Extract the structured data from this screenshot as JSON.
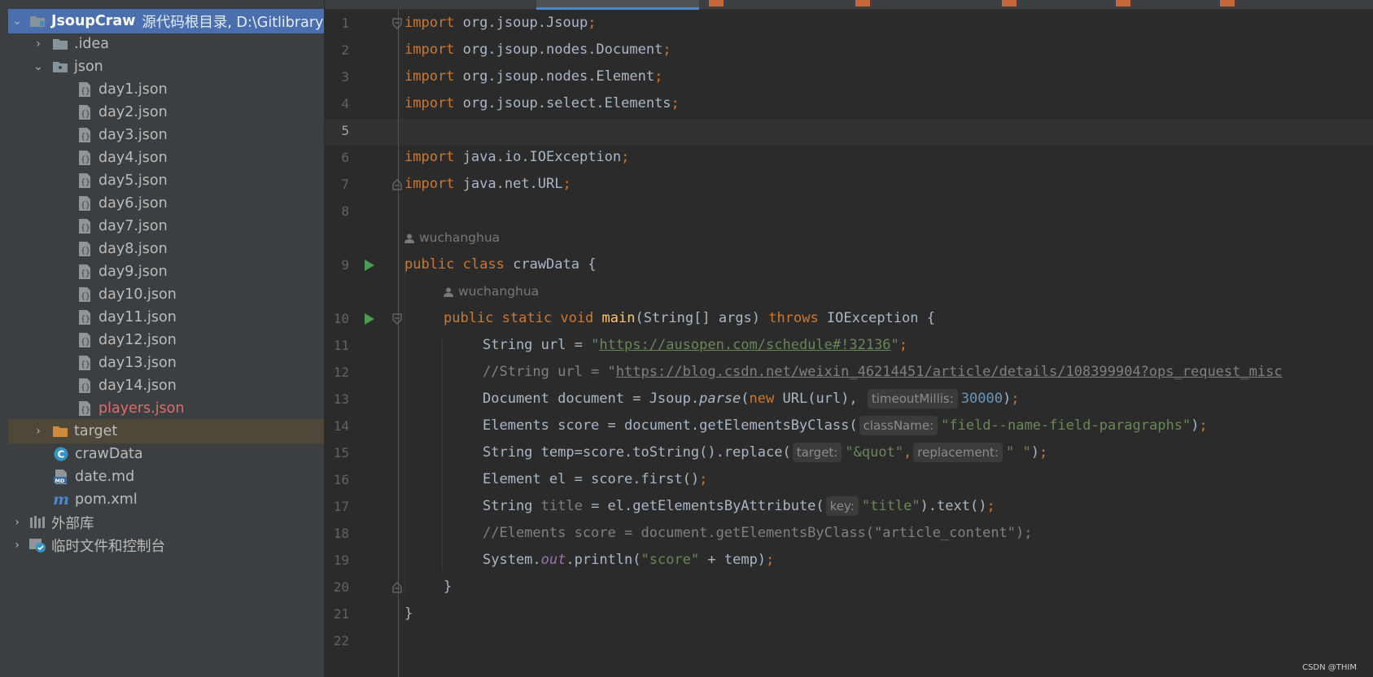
{
  "project_panel": {
    "root_name": "JsoupCraw",
    "root_path": "源代码根目录, D:\\Gitlibrary",
    "items": [
      {
        "label": ".idea"
      },
      {
        "label": "json"
      },
      {
        "label": "day1.json"
      },
      {
        "label": "day2.json"
      },
      {
        "label": "day3.json"
      },
      {
        "label": "day4.json"
      },
      {
        "label": "day5.json"
      },
      {
        "label": "day6.json"
      },
      {
        "label": "day7.json"
      },
      {
        "label": "day8.json"
      },
      {
        "label": "day9.json"
      },
      {
        "label": "day10.json"
      },
      {
        "label": "day11.json"
      },
      {
        "label": "day12.json"
      },
      {
        "label": "day13.json"
      },
      {
        "label": "day14.json"
      },
      {
        "label": "players.json"
      },
      {
        "label": "target"
      },
      {
        "label": "crawData"
      },
      {
        "label": "date.md"
      },
      {
        "label": "pom.xml"
      },
      {
        "label": "外部库"
      },
      {
        "label": "临时文件和控制台"
      }
    ]
  },
  "editor": {
    "line_numbers": [
      "1",
      "2",
      "3",
      "4",
      "5",
      "6",
      "7",
      "8",
      "9",
      "10",
      "11",
      "12",
      "13",
      "14",
      "15",
      "16",
      "17",
      "18",
      "19",
      "20",
      "21",
      "22"
    ],
    "author": "wuchanghua",
    "tokens": {
      "import": "import",
      "public": "public",
      "class": "class",
      "static": "static",
      "void": "void",
      "throws": "throws",
      "new": "new",
      "semi": ";",
      "l1": "org.jsoup.Jsoup",
      "l2": "org.jsoup.nodes.Document",
      "l3": "org.jsoup.nodes.Element",
      "l4": "org.jsoup.select.Elements",
      "l6": "java.io.IOException",
      "l7": "java.net.URL",
      "class_name": " crawData {",
      "main": "main",
      "main_rest": "(String[] args) ",
      "ioexc": " IOException {",
      "l11_a": "String url = ",
      "l11_url": "https://ausopen.com/schedule#!32136",
      "l12_a": "//String url = \"",
      "l12_url": "https://blog.csdn.net/weixin_46214451/article/details/108399904?ops_request_misc",
      "l13_a": "Document document = Jsoup.",
      "parse": "parse",
      "l13_b": "(",
      "l13_c": " URL(url), ",
      "hint_timeout": "timeoutMillis:",
      "num_30000": "30000",
      "l13_d": ")",
      "l14_a": "Elements score = document.getElementsByClass(",
      "hint_classname": "className:",
      "l14_str": "\"field--name-field-paragraphs\"",
      "l14_b": ")",
      "l15_a": "String temp=score.toString().replace(",
      "hint_target": "target:",
      "l15_str1": "\"&quot\"",
      "comma": ",",
      "hint_replacement": "replacement:",
      "l15_str2": "\" \"",
      "l15_b": ")",
      "l16_a": "Element el = score.first()",
      "l17_a": "String ",
      "title": "title",
      "l17_b": " = el.getElementsByAttribute(",
      "hint_key": "key:",
      "l17_str": "\"title\"",
      "l17_c": ").text()",
      "l18": "//Elements score = document.getElementsByClass(\"article_content\");",
      "l19_a": "System.",
      "out": "out",
      "l19_b": ".println(",
      "l19_str": "\"score\"",
      "l19_c": " + temp)",
      "rbrace": "}",
      "quote": "\""
    }
  },
  "watermark": "CSDN @THIM",
  "colors": {
    "keyword": "#cc7832",
    "string": "#6a8759",
    "comment": "#808080",
    "method": "#ffc66d",
    "number": "#6897bb",
    "selection": "#4b6eaf"
  }
}
